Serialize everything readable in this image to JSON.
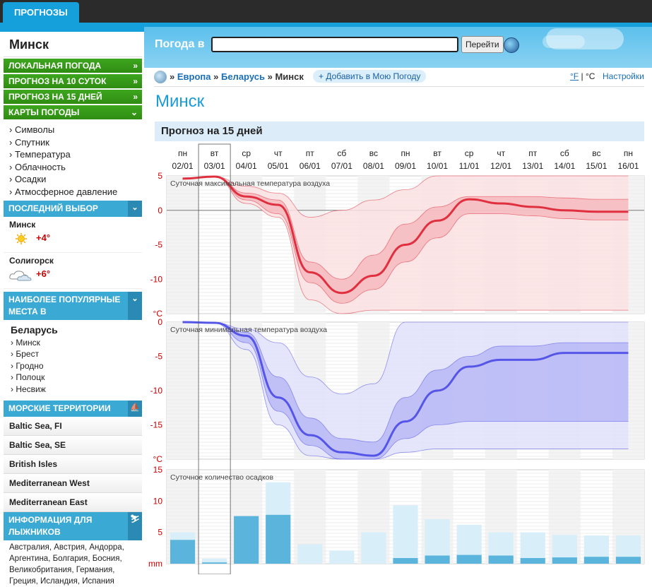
{
  "top_tab": "ПРОГНОЗЫ",
  "header": {
    "search_label": "Погода в",
    "search_value": "",
    "go_button": "Перейти"
  },
  "sidebar": {
    "city": "Минск",
    "nav": [
      {
        "label": "ЛОКАЛЬНАЯ ПОГОДА",
        "arrow": "»"
      },
      {
        "label": "ПРОГНОЗ НА 10 СУТОК",
        "arrow": "»"
      },
      {
        "label": "ПРОГНОЗ НА 15 ДНЕЙ",
        "arrow": "»"
      },
      {
        "label": "КАРТЫ ПОГОДЫ",
        "arrow": "»"
      }
    ],
    "maps": [
      "Символы",
      "Спутник",
      "Температура",
      "Облачность",
      "Осадки",
      "Атмосферное давление"
    ],
    "last_choice": {
      "title": "ПОСЛЕДНИЙ ВЫБОР",
      "items": [
        {
          "name": "Минск",
          "temp": "+4°",
          "icon": "sun-icon"
        },
        {
          "name": "Солигорск",
          "temp": "+6°",
          "icon": "cloud-rain-icon"
        }
      ]
    },
    "popular": {
      "title": "НАИБОЛЕЕ ПОПУЛЯРНЫЕ МЕСТА В",
      "country": "Беларусь",
      "items": [
        "Минск",
        "Брест",
        "Гродно",
        "Полоцк",
        "Несвиж"
      ]
    },
    "marine": {
      "title": "МОРСКИЕ ТЕРРИТОРИИ",
      "items": [
        "Baltic Sea, FI",
        "Baltic Sea, SE",
        "British Isles",
        "Mediterranean West",
        "Mediterranean East"
      ]
    },
    "ski": {
      "title": "ИНФОРМАЦИЯ ДЛЯ ЛЫЖНИКОВ",
      "text": "Австралия, Австрия, Андорра, Аргентина, Болгария, Босния, Великобритания, Германия, Греция, Исландия, Испания"
    }
  },
  "breadcrumb": {
    "sep": "»",
    "europe": "Европа",
    "belarus": "Беларусь",
    "city": "Минск",
    "add": "+ Добавить в Мою Погоду",
    "unit_f": "°F",
    "unit_sep": " | ",
    "unit_c": "°C",
    "settings": "Настройки"
  },
  "page_title": "Минск",
  "forecast_title": "Прогноз на 15 дней",
  "colors": {
    "accent": "#16a0db",
    "nav_green": "#3da61e",
    "tmax": "#e0303f",
    "tmin": "#5555e8",
    "precip": "#5ab4dc"
  },
  "chart_data": [
    {
      "type": "area",
      "title": "Суточная максимальная температура воздуха",
      "unit": "°C",
      "days": [
        "пн",
        "вт",
        "ср",
        "чт",
        "пт",
        "сб",
        "вс",
        "пн",
        "вт",
        "ср",
        "чт",
        "пт",
        "сб",
        "вс",
        "пн"
      ],
      "dates": [
        "02/01",
        "03/01",
        "04/01",
        "05/01",
        "06/01",
        "07/01",
        "08/01",
        "09/01",
        "10/01",
        "11/01",
        "12/01",
        "13/01",
        "14/01",
        "15/01",
        "16/01"
      ],
      "ylim": [
        -15,
        5
      ],
      "yticks": [
        5,
        0,
        -5,
        -10
      ],
      "median": [
        4.6,
        4.9,
        2.0,
        0.8,
        -9.0,
        -12.0,
        -9.5,
        -5.0,
        -1.5,
        1.6,
        1.0,
        0.5,
        0.0,
        -0.2,
        -0.2
      ],
      "p25": [
        4.6,
        4.9,
        1.5,
        -0.5,
        -10.5,
        -13.5,
        -11.5,
        -7.5,
        -4.0,
        -0.5,
        -0.5,
        -0.8,
        -1.2,
        -1.4,
        -1.4
      ],
      "p75": [
        4.6,
        4.9,
        2.5,
        1.5,
        -7.5,
        -10.0,
        -6.5,
        -2.0,
        0.5,
        2.0,
        2.0,
        2.0,
        1.8,
        1.6,
        1.6
      ],
      "min": [
        4.6,
        4.9,
        1.0,
        -1.0,
        -13.0,
        -15.0,
        -14.5,
        -14.5,
        -14.5,
        -14.5,
        -14.5,
        -14.5,
        -14.5,
        -14.5,
        -14.5
      ],
      "max": [
        4.6,
        4.9,
        3.5,
        2.5,
        -1.0,
        0.0,
        1.5,
        3.0,
        5.0,
        5.0,
        5.0,
        5.0,
        5.0,
        5.0,
        5.0
      ]
    },
    {
      "type": "area",
      "title": "Суточная минимальная температура воздуха",
      "unit": "°C",
      "ylim": [
        -20,
        0
      ],
      "yticks": [
        0,
        -5,
        -10,
        -15
      ],
      "median": [
        0,
        -0.1,
        -2.0,
        -11.0,
        -16.5,
        -19.0,
        -19.5,
        -14.5,
        -10.0,
        -6.5,
        -5.5,
        -5.5,
        -4.5,
        -4.5,
        -4.5
      ],
      "p25": [
        0,
        -0.1,
        -3.0,
        -13.0,
        -18.0,
        -20.0,
        -20.0,
        -17.0,
        -15.0,
        -14.5,
        -14.5,
        -14.5,
        -14.5,
        -14.5,
        -14.5
      ],
      "p75": [
        0,
        -0.1,
        -1.5,
        -8.0,
        -14.0,
        -17.0,
        -17.5,
        -11.0,
        -7.0,
        -5.0,
        -3.5,
        -3.5,
        -3.0,
        -3.0,
        -3.0
      ],
      "min": [
        0,
        -0.1,
        -4.0,
        -15.0,
        -19.5,
        -20.0,
        -20.0,
        -19.0,
        -18.5,
        -18.5,
        -18.5,
        -18.5,
        -18.5,
        -18.5,
        -18.5
      ],
      "max": [
        0,
        -0.1,
        -1.0,
        -3.0,
        -8.0,
        -10.5,
        -9.0,
        0.0,
        0.0,
        0.0,
        0.0,
        0.0,
        0.0,
        0.0,
        0.0
      ]
    },
    {
      "type": "bar",
      "title": "Суточное количество осадков",
      "unit": "mm",
      "ylim": [
        0,
        15
      ],
      "yticks": [
        15,
        10,
        5
      ],
      "values": [
        3.8,
        0.2,
        7.6,
        7.8,
        0.0,
        0.0,
        0.0,
        0.9,
        1.3,
        1.4,
        1.3,
        0.9,
        1.0,
        1.1,
        1.1
      ],
      "range": [
        5.0,
        0.8,
        7.6,
        13.0,
        3.1,
        2.1,
        5.0,
        9.3,
        7.1,
        6.2,
        5.0,
        5.0,
        4.6,
        4.5,
        4.5
      ]
    }
  ]
}
